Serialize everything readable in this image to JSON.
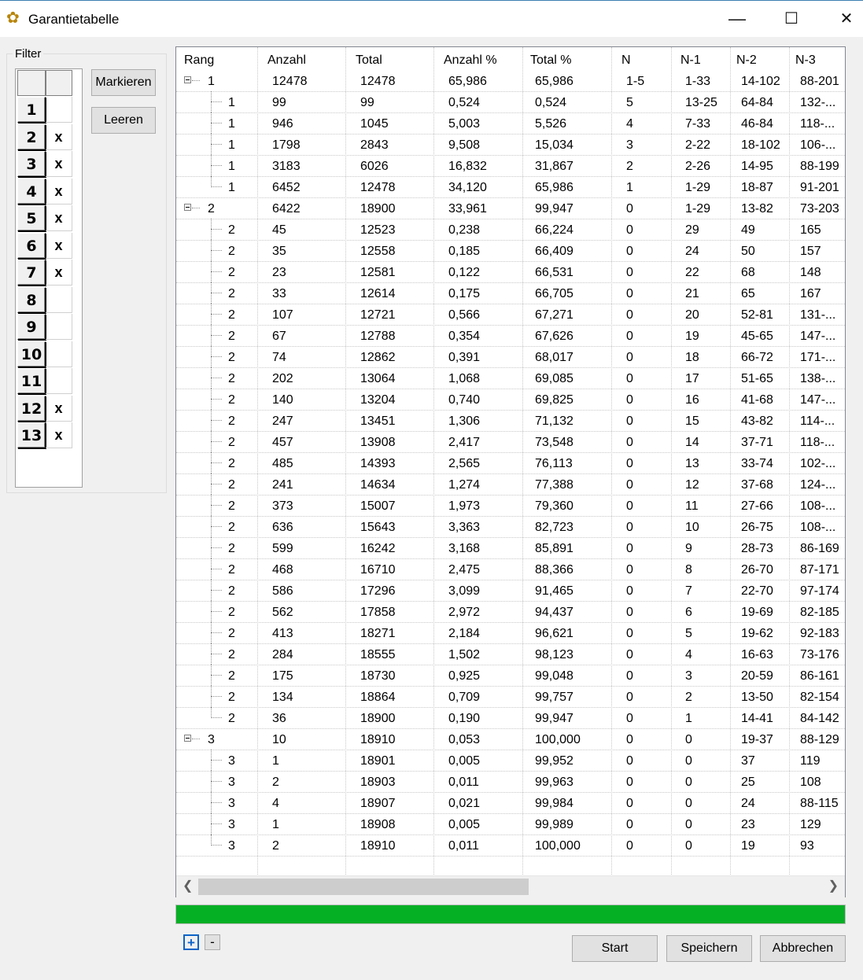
{
  "window": {
    "title": "Garantietabelle",
    "minimize": "—",
    "maximize": "☐",
    "close": "✕"
  },
  "filter": {
    "legend": "Filter",
    "rows": [
      {
        "n": "1",
        "x": ""
      },
      {
        "n": "2",
        "x": "x"
      },
      {
        "n": "3",
        "x": "x"
      },
      {
        "n": "4",
        "x": "x"
      },
      {
        "n": "5",
        "x": "x"
      },
      {
        "n": "6",
        "x": "x"
      },
      {
        "n": "7",
        "x": "x"
      },
      {
        "n": "8",
        "x": ""
      },
      {
        "n": "9",
        "x": ""
      },
      {
        "n": "10",
        "x": ""
      },
      {
        "n": "11",
        "x": ""
      },
      {
        "n": "12",
        "x": "x"
      },
      {
        "n": "13",
        "x": "x"
      }
    ],
    "mark_label": "Markieren",
    "clear_label": "Leeren"
  },
  "table": {
    "columns": [
      "Rang",
      "Anzahl",
      "Total",
      "Anzahl %",
      "Total %",
      "N",
      "N-1",
      "N-2",
      "N-3"
    ],
    "rows": [
      {
        "level": 0,
        "v": [
          "1",
          "12478",
          "12478",
          "65,986",
          "65,986",
          "1-5",
          "1-33",
          "14-102",
          "88-201"
        ]
      },
      {
        "level": 1,
        "v": [
          "1",
          "99",
          "99",
          "0,524",
          "0,524",
          "5",
          "13-25",
          "64-84",
          "132-..."
        ]
      },
      {
        "level": 1,
        "v": [
          "1",
          "946",
          "1045",
          "5,003",
          "5,526",
          "4",
          "7-33",
          "46-84",
          "118-..."
        ]
      },
      {
        "level": 1,
        "v": [
          "1",
          "1798",
          "2843",
          "9,508",
          "15,034",
          "3",
          "2-22",
          "18-102",
          "106-..."
        ]
      },
      {
        "level": 1,
        "v": [
          "1",
          "3183",
          "6026",
          "16,832",
          "31,867",
          "2",
          "2-26",
          "14-95",
          "88-199"
        ]
      },
      {
        "level": 1,
        "v": [
          "1",
          "6452",
          "12478",
          "34,120",
          "65,986",
          "1",
          "1-29",
          "18-87",
          "91-201"
        ],
        "last": true
      },
      {
        "level": 0,
        "v": [
          "2",
          "6422",
          "18900",
          "33,961",
          "99,947",
          "0",
          "1-29",
          "13-82",
          "73-203"
        ]
      },
      {
        "level": 1,
        "v": [
          "2",
          "45",
          "12523",
          "0,238",
          "66,224",
          "0",
          "29",
          "49",
          "165"
        ]
      },
      {
        "level": 1,
        "v": [
          "2",
          "35",
          "12558",
          "0,185",
          "66,409",
          "0",
          "24",
          "50",
          "157"
        ]
      },
      {
        "level": 1,
        "v": [
          "2",
          "23",
          "12581",
          "0,122",
          "66,531",
          "0",
          "22",
          "68",
          "148"
        ]
      },
      {
        "level": 1,
        "v": [
          "2",
          "33",
          "12614",
          "0,175",
          "66,705",
          "0",
          "21",
          "65",
          "167"
        ]
      },
      {
        "level": 1,
        "v": [
          "2",
          "107",
          "12721",
          "0,566",
          "67,271",
          "0",
          "20",
          "52-81",
          "131-..."
        ]
      },
      {
        "level": 1,
        "v": [
          "2",
          "67",
          "12788",
          "0,354",
          "67,626",
          "0",
          "19",
          "45-65",
          "147-..."
        ]
      },
      {
        "level": 1,
        "v": [
          "2",
          "74",
          "12862",
          "0,391",
          "68,017",
          "0",
          "18",
          "66-72",
          "171-..."
        ]
      },
      {
        "level": 1,
        "v": [
          "2",
          "202",
          "13064",
          "1,068",
          "69,085",
          "0",
          "17",
          "51-65",
          "138-..."
        ]
      },
      {
        "level": 1,
        "v": [
          "2",
          "140",
          "13204",
          "0,740",
          "69,825",
          "0",
          "16",
          "41-68",
          "147-..."
        ]
      },
      {
        "level": 1,
        "v": [
          "2",
          "247",
          "13451",
          "1,306",
          "71,132",
          "0",
          "15",
          "43-82",
          "114-..."
        ]
      },
      {
        "level": 1,
        "v": [
          "2",
          "457",
          "13908",
          "2,417",
          "73,548",
          "0",
          "14",
          "37-71",
          "118-..."
        ]
      },
      {
        "level": 1,
        "v": [
          "2",
          "485",
          "14393",
          "2,565",
          "76,113",
          "0",
          "13",
          "33-74",
          "102-..."
        ]
      },
      {
        "level": 1,
        "v": [
          "2",
          "241",
          "14634",
          "1,274",
          "77,388",
          "0",
          "12",
          "37-68",
          "124-..."
        ]
      },
      {
        "level": 1,
        "v": [
          "2",
          "373",
          "15007",
          "1,973",
          "79,360",
          "0",
          "11",
          "27-66",
          "108-..."
        ]
      },
      {
        "level": 1,
        "v": [
          "2",
          "636",
          "15643",
          "3,363",
          "82,723",
          "0",
          "10",
          "26-75",
          "108-..."
        ]
      },
      {
        "level": 1,
        "v": [
          "2",
          "599",
          "16242",
          "3,168",
          "85,891",
          "0",
          "9",
          "28-73",
          "86-169"
        ]
      },
      {
        "level": 1,
        "v": [
          "2",
          "468",
          "16710",
          "2,475",
          "88,366",
          "0",
          "8",
          "26-70",
          "87-171"
        ]
      },
      {
        "level": 1,
        "v": [
          "2",
          "586",
          "17296",
          "3,099",
          "91,465",
          "0",
          "7",
          "22-70",
          "97-174"
        ]
      },
      {
        "level": 1,
        "v": [
          "2",
          "562",
          "17858",
          "2,972",
          "94,437",
          "0",
          "6",
          "19-69",
          "82-185"
        ]
      },
      {
        "level": 1,
        "v": [
          "2",
          "413",
          "18271",
          "2,184",
          "96,621",
          "0",
          "5",
          "19-62",
          "92-183"
        ]
      },
      {
        "level": 1,
        "v": [
          "2",
          "284",
          "18555",
          "1,502",
          "98,123",
          "0",
          "4",
          "16-63",
          "73-176"
        ]
      },
      {
        "level": 1,
        "v": [
          "2",
          "175",
          "18730",
          "0,925",
          "99,048",
          "0",
          "3",
          "20-59",
          "86-161"
        ]
      },
      {
        "level": 1,
        "v": [
          "2",
          "134",
          "18864",
          "0,709",
          "99,757",
          "0",
          "2",
          "13-50",
          "82-154"
        ]
      },
      {
        "level": 1,
        "v": [
          "2",
          "36",
          "18900",
          "0,190",
          "99,947",
          "0",
          "1",
          "14-41",
          "84-142"
        ],
        "last": true
      },
      {
        "level": 0,
        "v": [
          "3",
          "10",
          "18910",
          "0,053",
          "100,000",
          "0",
          "0",
          "19-37",
          "88-129"
        ]
      },
      {
        "level": 1,
        "v": [
          "3",
          "1",
          "18901",
          "0,005",
          "99,952",
          "0",
          "0",
          "37",
          "119"
        ]
      },
      {
        "level": 1,
        "v": [
          "3",
          "2",
          "18903",
          "0,011",
          "99,963",
          "0",
          "0",
          "25",
          "108"
        ]
      },
      {
        "level": 1,
        "v": [
          "3",
          "4",
          "18907",
          "0,021",
          "99,984",
          "0",
          "0",
          "24",
          "88-115"
        ]
      },
      {
        "level": 1,
        "v": [
          "3",
          "1",
          "18908",
          "0,005",
          "99,989",
          "0",
          "0",
          "23",
          "129"
        ]
      },
      {
        "level": 1,
        "v": [
          "3",
          "2",
          "18910",
          "0,011",
          "100,000",
          "0",
          "0",
          "19",
          "93"
        ],
        "last": true
      }
    ]
  },
  "progress": {
    "value": 1.0,
    "color": "#06b025"
  },
  "buttons": {
    "expand": "+",
    "collapse": "-",
    "start": "Start",
    "save": "Speichern",
    "cancel": "Abbrechen"
  }
}
